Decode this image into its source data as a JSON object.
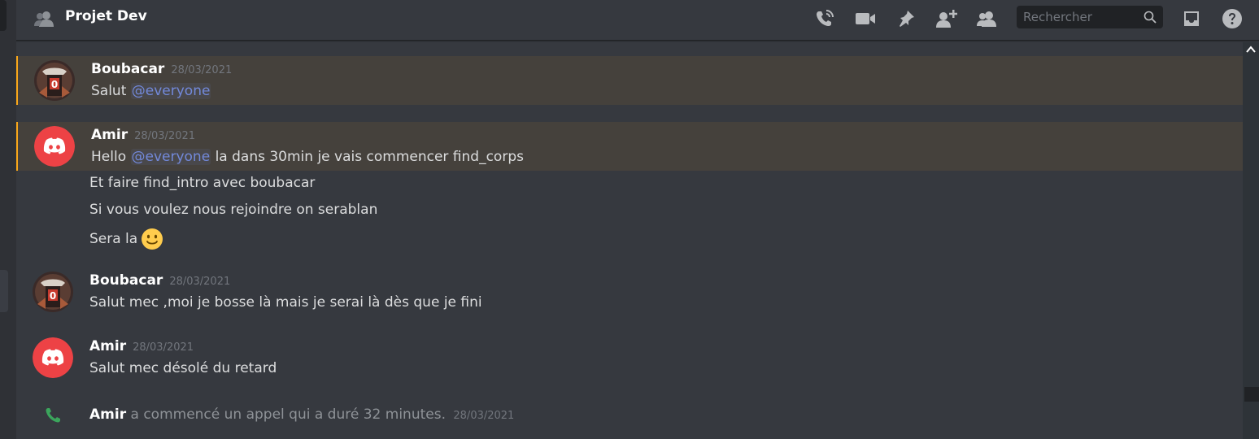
{
  "channel": {
    "title": "Projet Dev"
  },
  "header": {
    "icons": [
      "call-icon",
      "video-icon",
      "pin-icon",
      "add-member-icon",
      "members-icon",
      "inbox-icon",
      "help-icon"
    ],
    "search_placeholder": "Rechercher"
  },
  "colors": {
    "accent": "#7289da",
    "mention_bar": "#faa81a",
    "call_green": "#3ba55c",
    "discord_red": "#ed4245"
  },
  "messages": [
    {
      "author": "Boubacar",
      "timestamp": "28/03/2021",
      "lines": [
        {
          "pre": "Salut ",
          "mention": "@everyone",
          "post": ""
        }
      ]
    },
    {
      "author": "Amir",
      "timestamp": "28/03/2021",
      "lines": [
        {
          "pre": "Hello ",
          "mention": "@everyone",
          "post": " la dans 30min je vais commencer find_corps"
        },
        {
          "text": "Et faire find_intro avec boubacar"
        },
        {
          "text": "Si vous voulez nous rejoindre on serablan"
        },
        {
          "text": "Sera la",
          "emoji": "slightly-smiling-face"
        }
      ]
    },
    {
      "author": "Boubacar",
      "timestamp": "28/03/2021",
      "lines": [
        {
          "text": "Salut mec ,moi je bosse là mais je serai là dès que je fini"
        }
      ]
    },
    {
      "author": "Amir",
      "timestamp": "28/03/2021",
      "lines": [
        {
          "text": "Salut mec désolé du retard"
        }
      ]
    }
  ],
  "system": {
    "author": "Amir",
    "text": "a commencé un appel qui a duré 32 minutes.",
    "timestamp": "28/03/2021"
  }
}
